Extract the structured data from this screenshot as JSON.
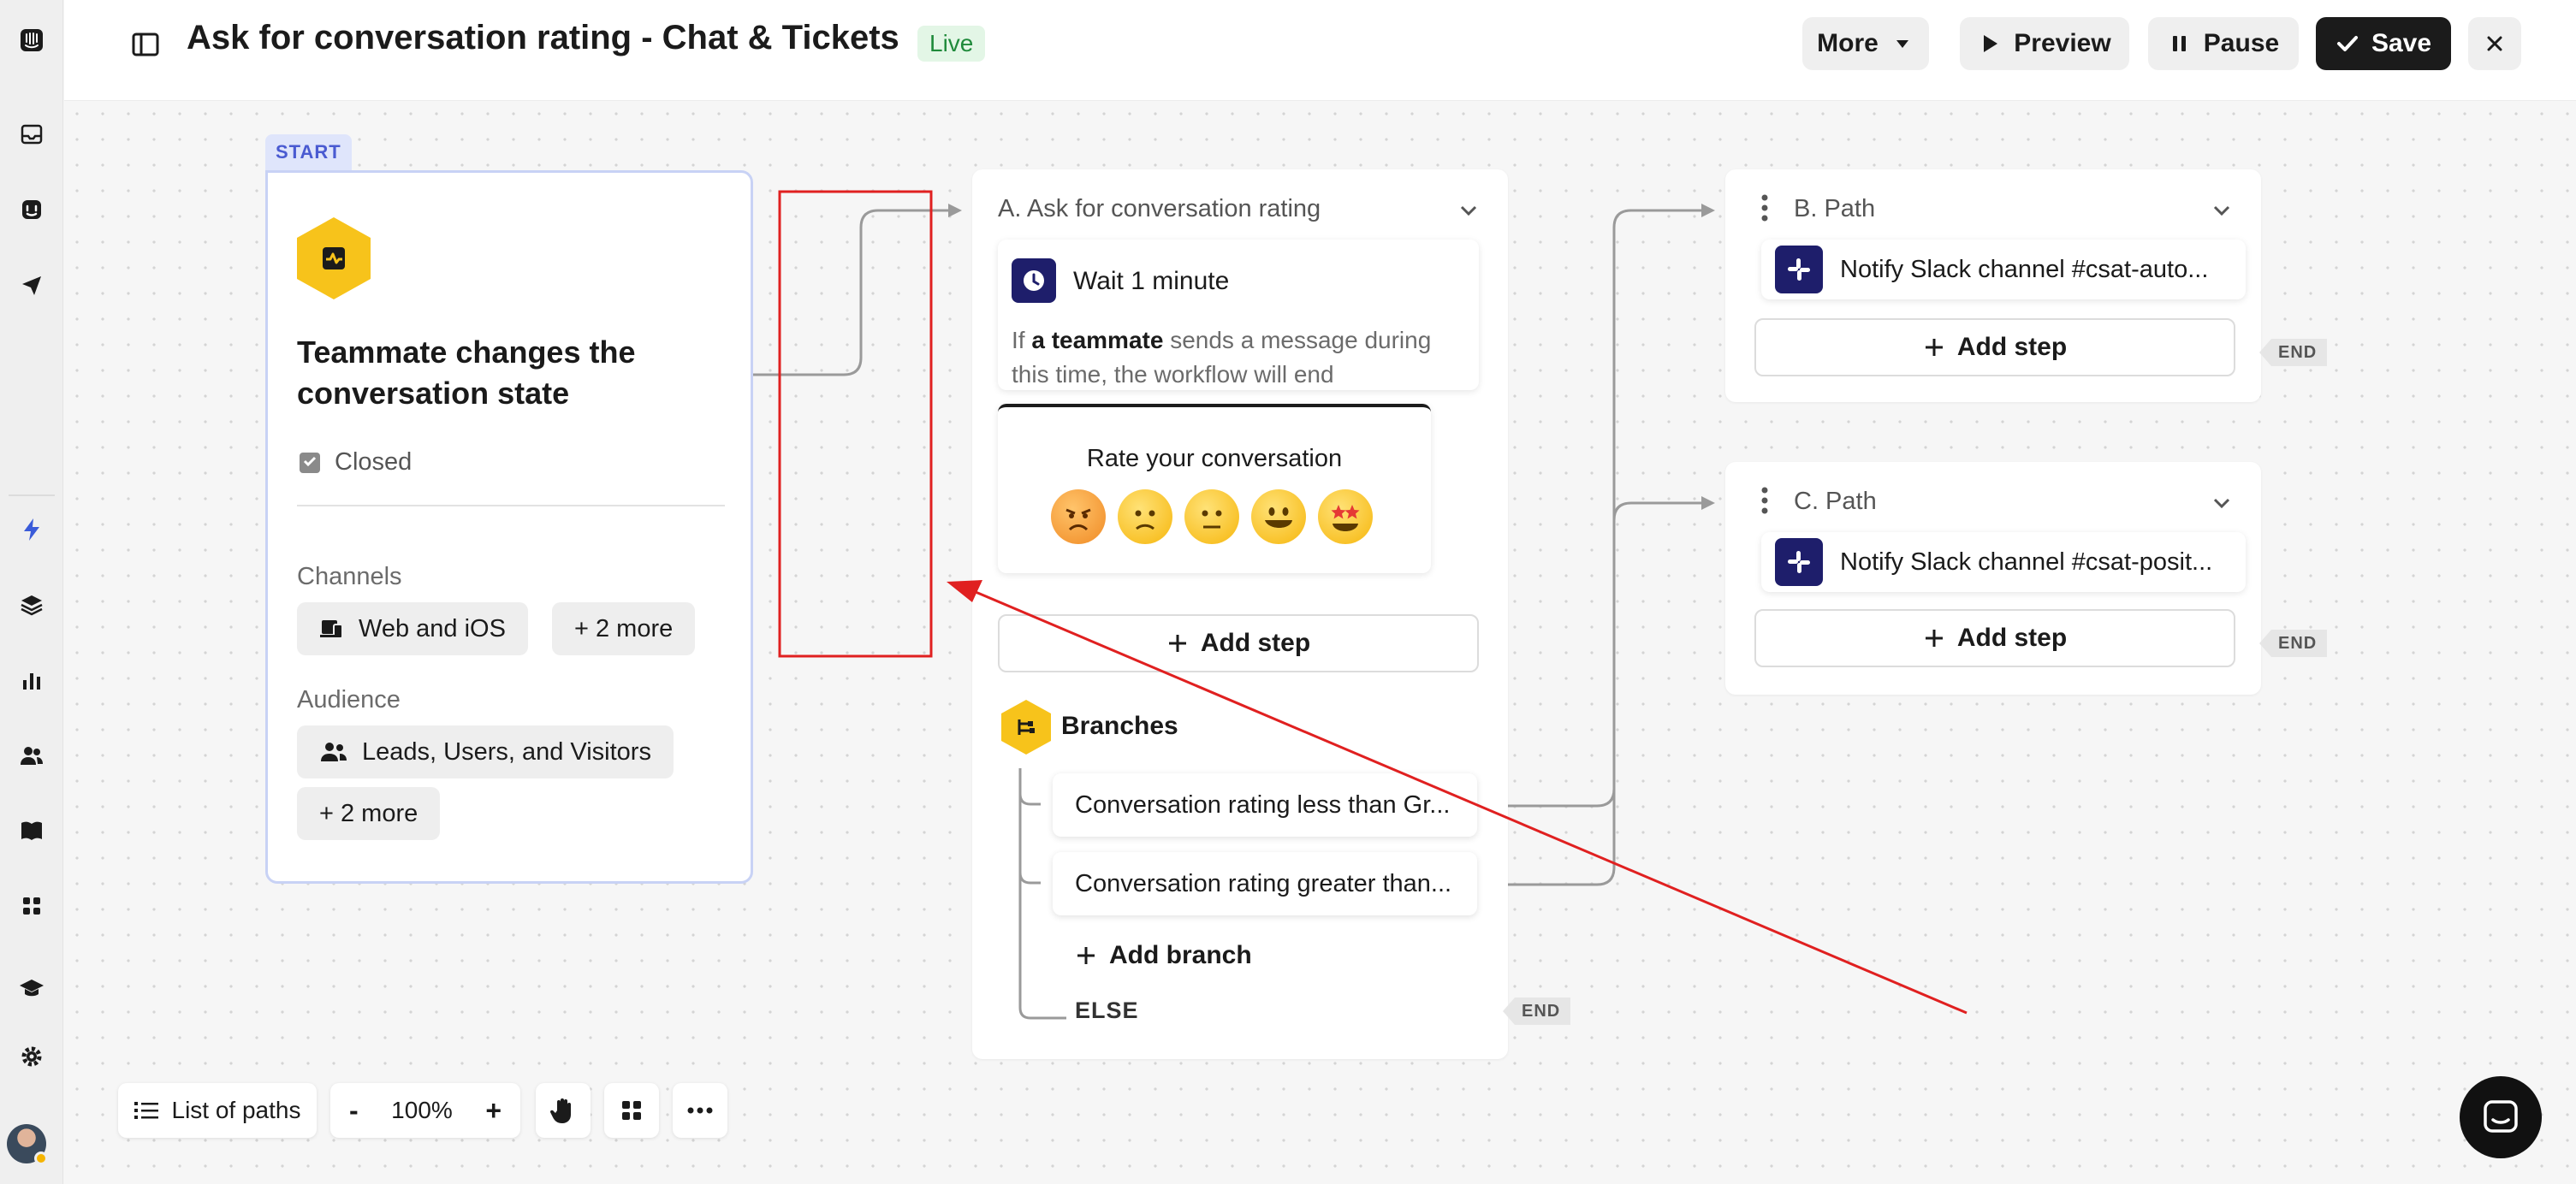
{
  "header": {
    "title": "Ask for conversation rating - Chat & Tickets",
    "status": "Live",
    "more_label": "More",
    "preview_label": "Preview",
    "pause_label": "Pause",
    "save_label": "Save"
  },
  "start_node": {
    "badge": "START",
    "title": "Teammate changes the conversation state",
    "condition": "Closed",
    "channels_label": "Channels",
    "channel_value": "Web and iOS",
    "channel_more": "+ 2 more",
    "audience_label": "Audience",
    "audience_value": "Leads, Users, and Visitors",
    "audience_more": "+ 2 more"
  },
  "step_a": {
    "title": "A. Ask for conversation rating",
    "wait_label": "Wait 1 minute",
    "wait_desc_prefix": "If",
    "wait_desc_bold": "a teammate",
    "wait_desc_suffix": "sends a message during this time, the workflow will end",
    "rating_title": "Rate your conversation",
    "add_step": "Add step",
    "branches_label": "Branches",
    "branch_1": "Conversation rating less than Gr...",
    "branch_2": "Conversation rating greater than...",
    "add_branch": "Add branch",
    "else_label": "ELSE",
    "end_label": "END"
  },
  "path_b": {
    "title": "B. Path",
    "action": "Notify Slack channel #csat-auto...",
    "add_step": "Add step",
    "end_label": "END"
  },
  "path_c": {
    "title": "C. Path",
    "action": "Notify Slack channel #csat-posit...",
    "add_step": "Add step",
    "end_label": "END"
  },
  "toolbar": {
    "list_paths": "List of paths",
    "zoom_out": "-",
    "zoom": "100%",
    "zoom_in": "+"
  },
  "colors": {
    "accent_yellow": "#f7c31b",
    "start_border": "#c8d2f5",
    "live_green": "#1f8a3b",
    "annotation_red": "#e02020",
    "slack_navy": "#1e1e6b"
  }
}
